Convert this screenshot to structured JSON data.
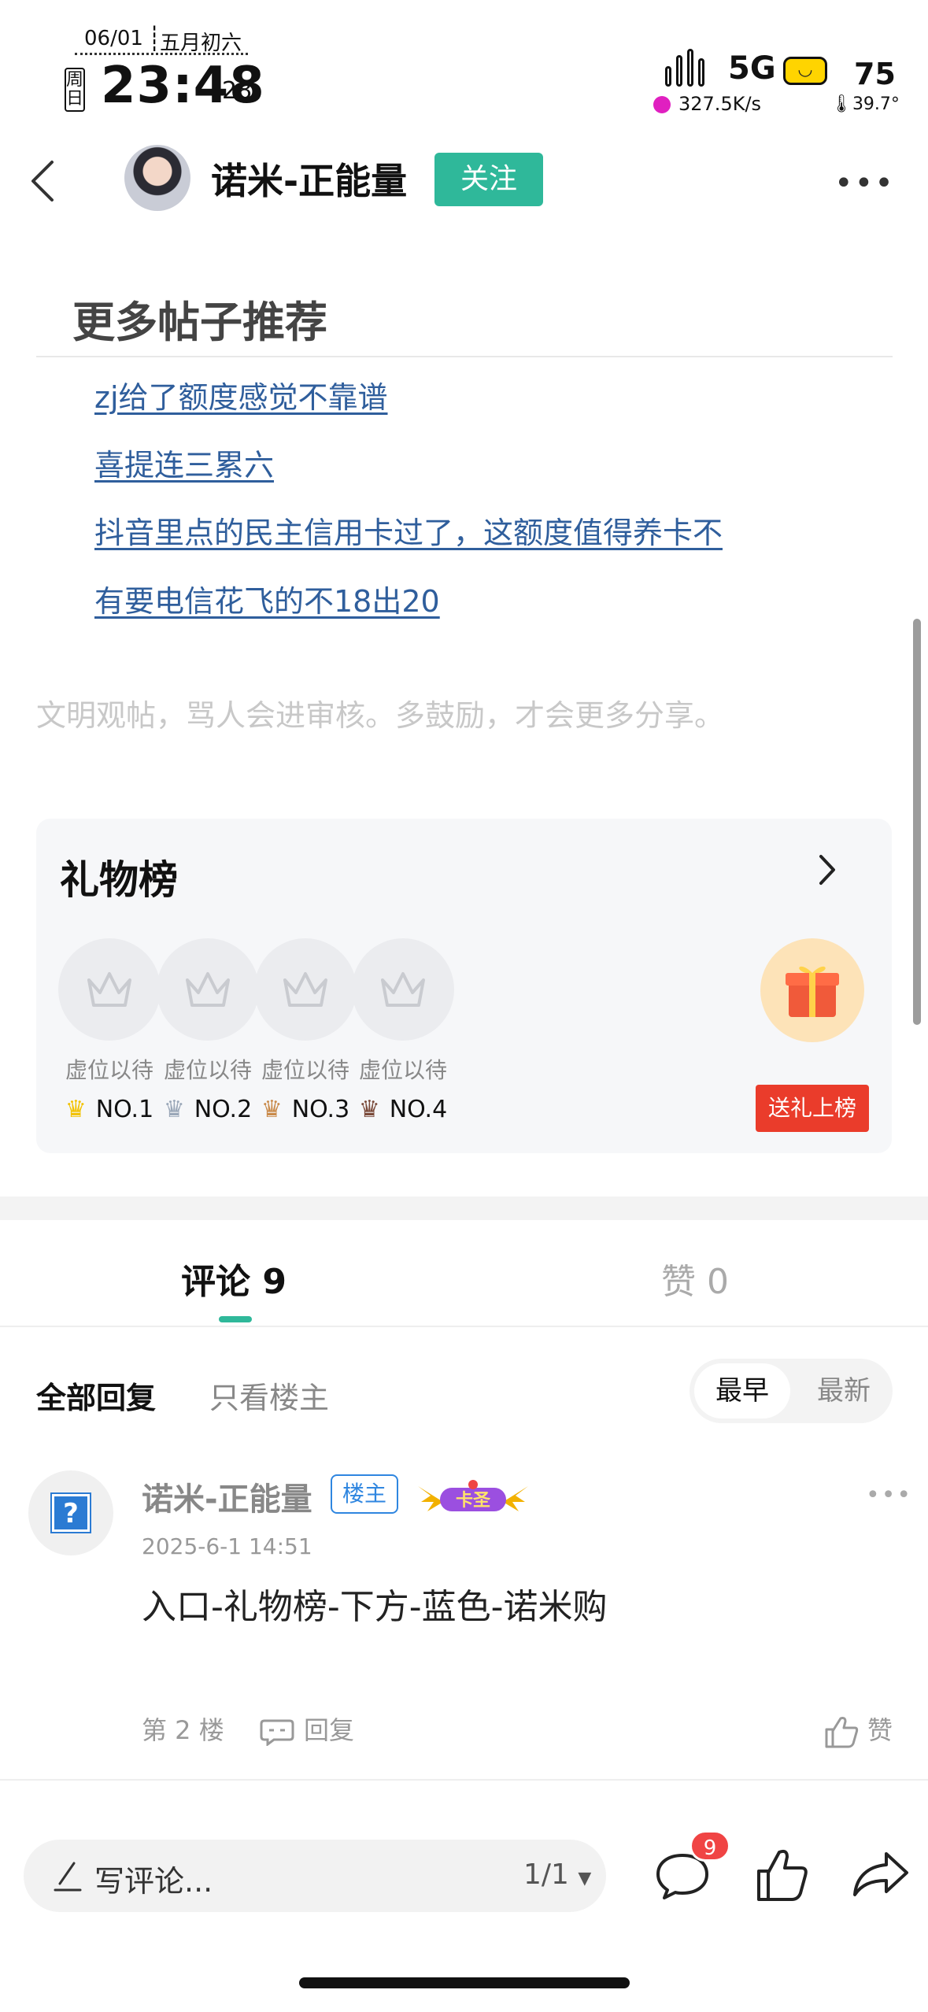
{
  "status": {
    "date": "06/01",
    "lunar": "五月初六",
    "weekday": "周日",
    "time": "23:48",
    "seconds": "28",
    "network": "5G",
    "battery": "75",
    "speed": "327.5K/s",
    "temp": "39.7°"
  },
  "header": {
    "author": "诺米-正能量",
    "follow": "关注"
  },
  "more_posts": {
    "title": "更多帖子推荐",
    "links": [
      "zj给了额度感觉不靠谱",
      "喜提连三累六",
      "抖音里点的民主信用卡过了，这额度值得养卡不",
      "有要电信花飞的不18出20"
    ]
  },
  "notice": "文明观帖，骂人会进审核。多鼓励，才会更多分享。",
  "gift_board": {
    "title": "礼物榜",
    "slots": [
      {
        "label": "虚位以待",
        "rank": "NO.1",
        "crown_color": "#f2c200"
      },
      {
        "label": "虚位以待",
        "rank": "NO.2",
        "crown_color": "#9aa7b8"
      },
      {
        "label": "虚位以待",
        "rank": "NO.3",
        "crown_color": "#c98a4a"
      },
      {
        "label": "虚位以待",
        "rank": "NO.4",
        "crown_color": "#7a4a3a"
      }
    ],
    "send": "送礼上榜"
  },
  "tabs": {
    "comment": "评论 9",
    "like": "赞 0"
  },
  "filters": {
    "all": "全部回复",
    "op_only": "只看楼主",
    "sort_early": "最早",
    "sort_new": "最新"
  },
  "comment": {
    "name": "诺米-正能量",
    "owner_tag": "楼主",
    "badge": "卡圣",
    "time": "2025-6-1 14:51",
    "text": "入口-礼物榜-下方-蓝色-诺米购",
    "floor": "第 2 楼",
    "reply": "回复",
    "like": "赞"
  },
  "bottom": {
    "placeholder": "写评论...",
    "page": "1/1",
    "comment_count": "9"
  },
  "colors": {
    "accent": "#2fb89a",
    "link": "#2f5e9c",
    "red": "#ea3c2b"
  }
}
